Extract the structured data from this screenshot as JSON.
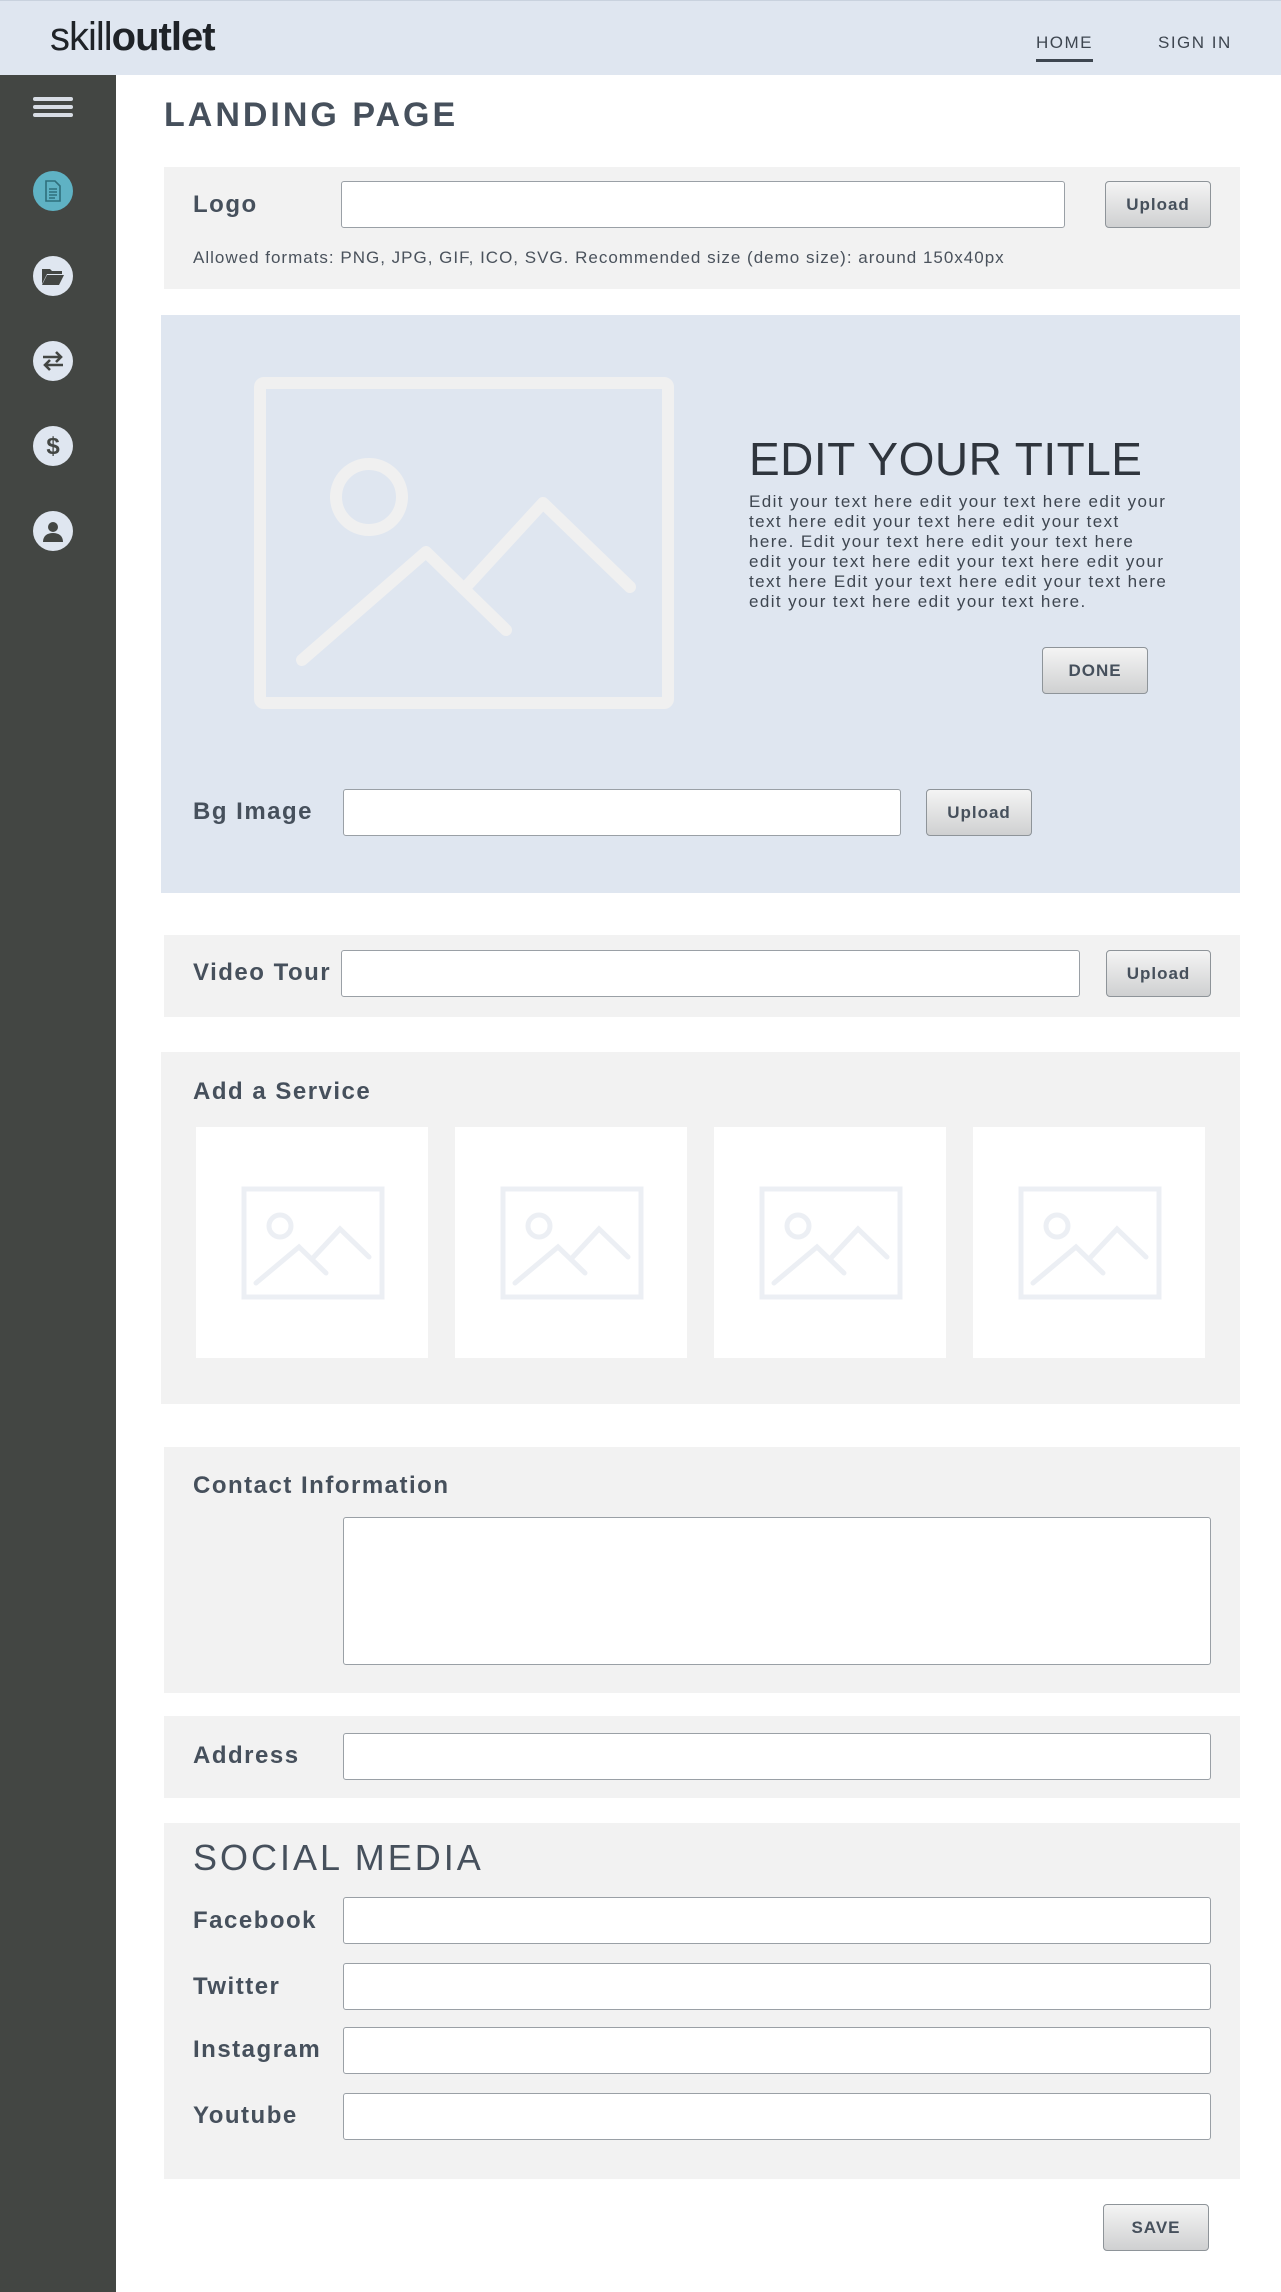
{
  "header": {
    "brand_light": "skill",
    "brand_bold": "outlet",
    "nav": {
      "home": "HOME",
      "signin": "SIGN IN"
    }
  },
  "sidebar": {
    "items": [
      {
        "icon": "document-icon",
        "active": true
      },
      {
        "icon": "folder-icon",
        "active": false
      },
      {
        "icon": "transfer-icon",
        "active": false
      },
      {
        "icon": "dollar-icon",
        "active": false
      },
      {
        "icon": "user-icon",
        "active": false
      }
    ]
  },
  "page": {
    "title": "LANDING PAGE"
  },
  "logo_section": {
    "label": "Logo",
    "value": "",
    "upload_label": "Upload",
    "hint": "Allowed formats: PNG, JPG, GIF, ICO, SVG. Recommended size (demo size): around 150x40px"
  },
  "hero": {
    "title": "EDIT YOUR TITLE",
    "text": "Edit your text here edit your text here edit your text here edit your text here edit your text here. Edit your text here edit your text here edit your text here edit your text here edit your text here Edit your text here edit your text here edit your text here edit your text here.",
    "done_label": "DONE",
    "bg_label": "Bg Image",
    "bg_value": "",
    "bg_upload_label": "Upload"
  },
  "video": {
    "label": "Video Tour",
    "value": "",
    "upload_label": "Upload"
  },
  "services": {
    "label": "Add a Service"
  },
  "contact": {
    "label": "Contact Information",
    "value": ""
  },
  "address": {
    "label": "Address",
    "value": ""
  },
  "social": {
    "title": "SOCIAL MEDIA",
    "facebook": {
      "label": "Facebook",
      "value": ""
    },
    "twitter": {
      "label": "Twitter",
      "value": ""
    },
    "instagram": {
      "label": "Instagram",
      "value": ""
    },
    "youtube": {
      "label": "Youtube",
      "value": ""
    }
  },
  "save_label": "SAVE",
  "colors": {
    "header_bg": "#dfe6f0",
    "sidebar_bg": "#434643",
    "active_icon": "#5fb2c4",
    "panel_bg": "#f2f2f2",
    "text": "#46505c"
  }
}
